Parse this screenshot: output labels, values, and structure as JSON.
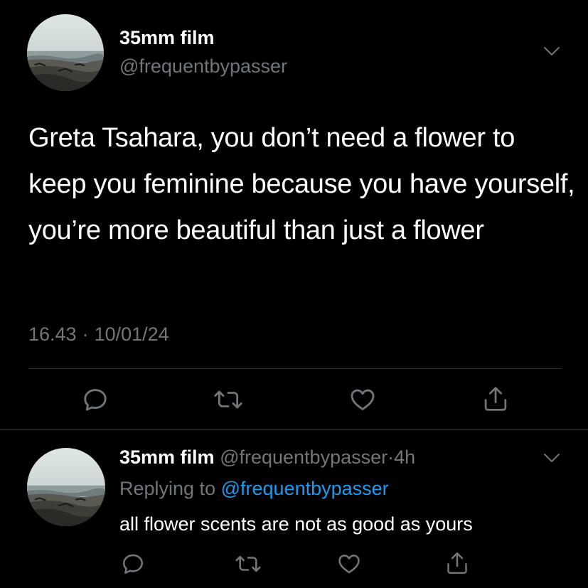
{
  "colors": {
    "background": "#000000",
    "primary_text": "#ffffff",
    "secondary_text": "#71767b",
    "link": "#1d9bf0",
    "divider": "#2f3336",
    "icon": "#71767b"
  },
  "main_tweet": {
    "display_name": "35mm film",
    "handle": "@frequentbypasser",
    "text": "Greta Tsahara, you don’t need a flower to keep you feminine because you have yourself, you’re more beautiful than just a flower",
    "time": "16.43",
    "separator": "·",
    "date": "10/01/24",
    "avatar_icon": "beach-avatar-icon",
    "menu_icon": "chevron-down-icon",
    "actions": [
      {
        "name": "reply",
        "icon": "reply-icon"
      },
      {
        "name": "retweet",
        "icon": "retweet-icon"
      },
      {
        "name": "like",
        "icon": "heart-icon"
      },
      {
        "name": "share",
        "icon": "share-icon"
      }
    ]
  },
  "reply_tweet": {
    "display_name": "35mm film",
    "handle": "@frequentbypasser",
    "separator": "·",
    "time_ago": "4h",
    "replying_prefix": "Replying to",
    "replying_handle": "@frequentbypasser",
    "text": "all flower scents are not as good as yours",
    "avatar_icon": "beach-avatar-icon",
    "menu_icon": "chevron-down-icon",
    "actions": [
      {
        "name": "reply",
        "icon": "reply-icon"
      },
      {
        "name": "retweet",
        "icon": "retweet-icon"
      },
      {
        "name": "like",
        "icon": "heart-icon"
      },
      {
        "name": "share",
        "icon": "share-icon"
      }
    ]
  }
}
